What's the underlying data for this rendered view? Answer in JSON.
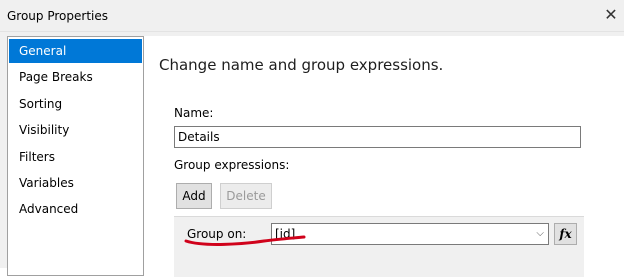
{
  "window": {
    "title": "Group Properties",
    "close_icon": "close-icon"
  },
  "sidebar": {
    "items": [
      {
        "label": "General",
        "selected": true
      },
      {
        "label": "Page Breaks",
        "selected": false
      },
      {
        "label": "Sorting",
        "selected": false
      },
      {
        "label": "Visibility",
        "selected": false
      },
      {
        "label": "Filters",
        "selected": false
      },
      {
        "label": "Variables",
        "selected": false
      },
      {
        "label": "Advanced",
        "selected": false
      }
    ]
  },
  "main": {
    "heading": "Change name and group expressions.",
    "name_label": "Name:",
    "name_value": "Details",
    "group_expressions_label": "Group expressions:",
    "add_label": "Add",
    "delete_label": "Delete",
    "group_on_label": "Group on:",
    "group_on_value": "[id]",
    "fx_label": "fx"
  },
  "colors": {
    "accent": "#0078d7",
    "annotation": "#d0021b"
  }
}
